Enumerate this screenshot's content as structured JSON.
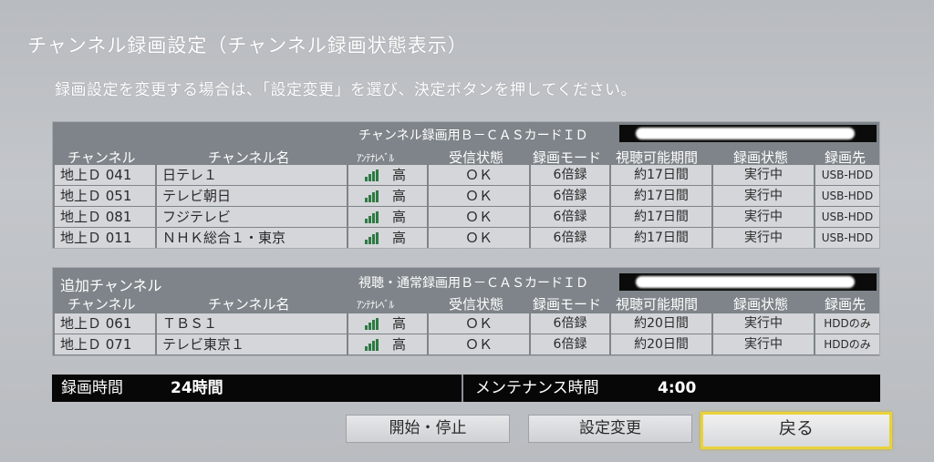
{
  "title": "チャンネル録画設定（チャンネル録画状態表示）",
  "instruction": "録画設定を変更する場合は、「設定変更」を選び、決定ボタンを押してください。",
  "headers": {
    "channel": "チャンネル",
    "channel_name": "チャンネル名",
    "antenna_level": "ｱﾝﾃﾅﾚﾍﾞﾙ",
    "reception": "受信状態",
    "mode": "録画モード",
    "period": "視聴可能期間",
    "state": "録画状態",
    "destination": "録画先"
  },
  "section1": {
    "card_label": "チャンネル録画用Ｂ－ＣＡＳカードＩＤ",
    "rows": [
      {
        "channel": "地上Ｄ 041",
        "name": "日テレ１",
        "level": "高",
        "reception": "ＯＫ",
        "mode": "6倍録",
        "period": "約17日間",
        "state": "実行中",
        "dest": "USB-HDD"
      },
      {
        "channel": "地上Ｄ 051",
        "name": "テレビ朝日",
        "level": "高",
        "reception": "ＯＫ",
        "mode": "6倍録",
        "period": "約17日間",
        "state": "実行中",
        "dest": "USB-HDD"
      },
      {
        "channel": "地上Ｄ 081",
        "name": "フジテレビ",
        "level": "高",
        "reception": "ＯＫ",
        "mode": "6倍録",
        "period": "約17日間",
        "state": "実行中",
        "dest": "USB-HDD"
      },
      {
        "channel": "地上Ｄ 011",
        "name": "ＮＨＫ総合１・東京",
        "level": "高",
        "reception": "ＯＫ",
        "mode": "6倍録",
        "period": "約17日間",
        "state": "実行中",
        "dest": "USB-HDD"
      }
    ]
  },
  "section2": {
    "title": "追加チャンネル",
    "card_label": "視聴・通常録画用Ｂ－ＣＡＳカードＩＤ",
    "rows": [
      {
        "channel": "地上Ｄ 061",
        "name": "ＴＢＳ１",
        "level": "高",
        "reception": "ＯＫ",
        "mode": "6倍録",
        "period": "約20日間",
        "state": "実行中",
        "dest": "HDDのみ"
      },
      {
        "channel": "地上Ｄ 071",
        "name": "テレビ東京１",
        "level": "高",
        "reception": "ＯＫ",
        "mode": "6倍録",
        "period": "約20日間",
        "state": "実行中",
        "dest": "HDDのみ"
      }
    ]
  },
  "status": {
    "record_time_label": "録画時間",
    "record_time_value": "24時間",
    "maintenance_label": "メンテナンス時間",
    "maintenance_value": "4:00"
  },
  "buttons": {
    "start_stop": "開始・停止",
    "change_settings": "設定変更",
    "back": "戻る"
  },
  "colors": {
    "background": "#c0c3c7",
    "panel": "#7e8489",
    "cell": "#d4d6d9",
    "signal": "#2d7a43",
    "focus_border": "#e8d23a"
  },
  "icons": {
    "antenna_level": "signal-bars-icon"
  }
}
